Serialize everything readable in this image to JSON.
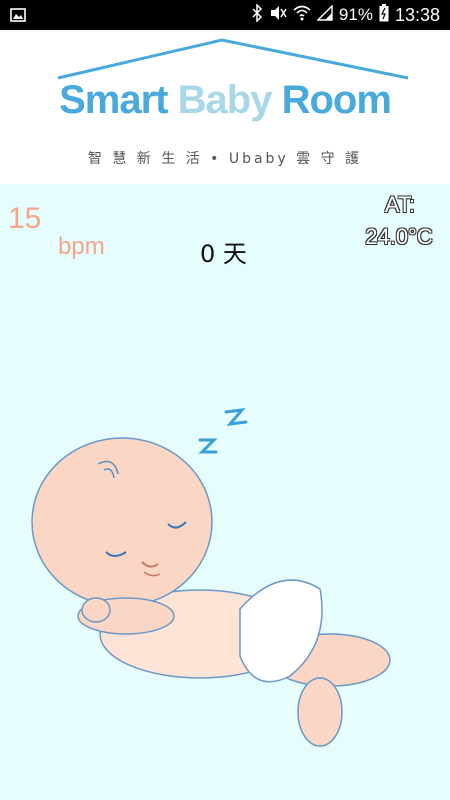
{
  "status_bar": {
    "battery": "91%",
    "time": "13:38",
    "icons": [
      "image-icon",
      "bluetooth-icon",
      "mute-icon",
      "wifi-icon",
      "signal-icon",
      "battery-icon"
    ]
  },
  "header": {
    "logo": {
      "word1": "Smart",
      "word2": "Baby",
      "word3": "Room",
      "colors": {
        "primary": "#48a9dc",
        "light": "#a8d8e8"
      }
    },
    "tagline": "智 慧 新 生 活 • Ubaby 雲 守 護"
  },
  "main": {
    "background": "#e6fdfd",
    "heart_rate": {
      "value": "15",
      "unit": "bpm",
      "color": "#f4a58c"
    },
    "days": "0 天",
    "temperature": {
      "label": "AT:",
      "value": "24.0°C"
    },
    "illustration": "sleeping-baby"
  }
}
